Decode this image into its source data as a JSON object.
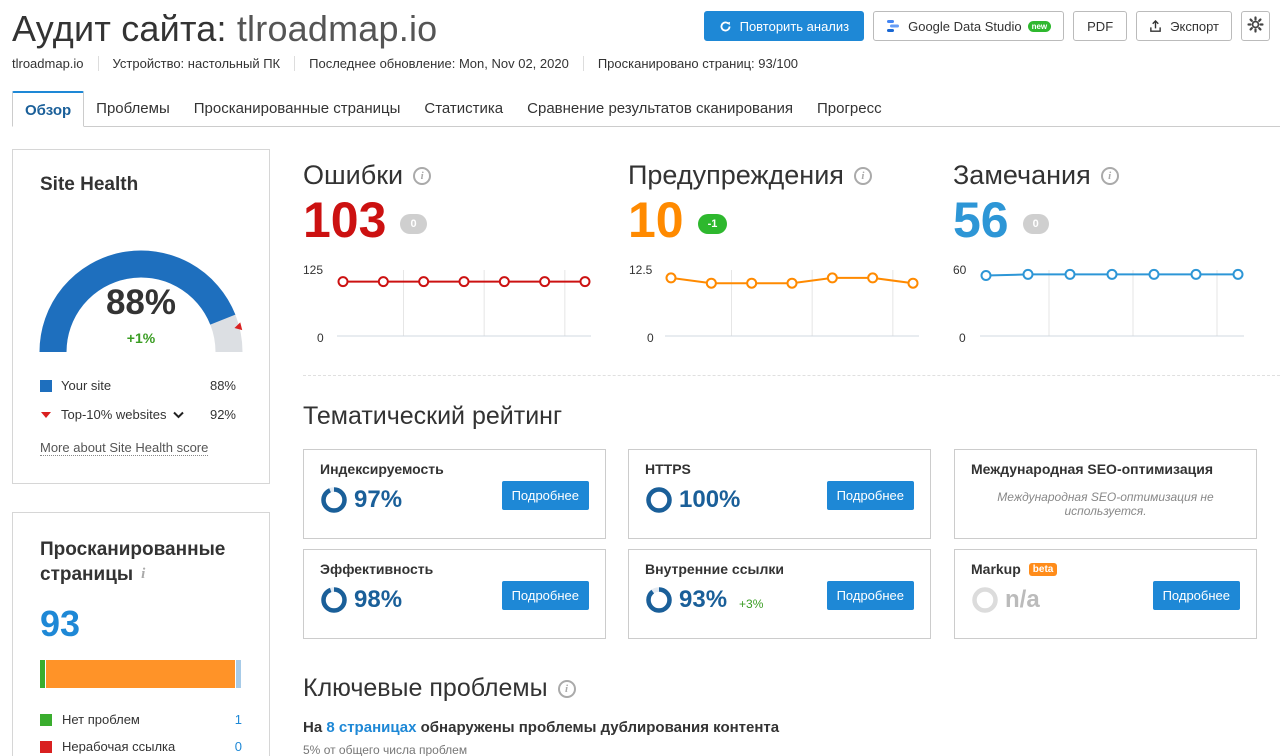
{
  "header": {
    "title_prefix": "Аудит сайта:",
    "title_domain": "tlroadmap.io"
  },
  "toolbar": {
    "rerun_label": "Повторить анализ",
    "gds_label": "Google Data Studio",
    "gds_badge": "new",
    "pdf_label": "PDF",
    "export_label": "Экспорт"
  },
  "meta": {
    "domain": "tlroadmap.io",
    "device": "Устройство: настольный ПК",
    "last_update": "Последнее обновление: Mon, Nov 02, 2020",
    "crawled": "Просканировано страниц: 93/100"
  },
  "tabs": [
    {
      "label": "Обзор",
      "active": true
    },
    {
      "label": "Проблемы"
    },
    {
      "label": "Просканированные страницы"
    },
    {
      "label": "Статистика"
    },
    {
      "label": "Сравнение результатов сканирования"
    },
    {
      "label": "Прогресс"
    }
  ],
  "site_health": {
    "title": "Site Health",
    "value": "88%",
    "value_fraction": 0.88,
    "delta": "+1%",
    "top10_fraction": 0.92,
    "your_site_label": "Your site",
    "your_site_value": "88%",
    "top10_label": "Top-10% websites",
    "top10_value": "92%",
    "more_link": "More about Site Health score",
    "colors": {
      "site": "#1e6fbe",
      "rest": "#dcdfe3",
      "marker": "#d92020"
    }
  },
  "crawled_pages": {
    "title_line1": "Просканированные",
    "title_line2": "страницы",
    "count": "93",
    "bar": [
      {
        "name": "Нет проблем",
        "count": 1,
        "color": "#3aad2e"
      },
      {
        "name": "Нерабочая ссылка",
        "count": 0,
        "color": "#d92020"
      },
      {
        "name": "segment-orange",
        "count": 91,
        "color": "#ff9328"
      },
      {
        "name": "segment-blue",
        "count": 1,
        "color": "#a7cbe8"
      }
    ],
    "statuses": [
      {
        "label": "Нет проблем",
        "value": "1",
        "color": "#3aad2e"
      },
      {
        "label": "Нерабочая ссылка",
        "value": "0",
        "color": "#d92020"
      }
    ]
  },
  "metrics": [
    {
      "name": "Ошибки",
      "value": "103",
      "badge": "0",
      "badge_color": "#cfcfcf",
      "color": "#cc1111",
      "y_max": "125",
      "y_min": "0",
      "y_max_num": 125,
      "series": [
        103,
        103,
        103,
        103,
        103,
        103,
        103
      ]
    },
    {
      "name": "Предупреждения",
      "value": "10",
      "badge": "-1",
      "badge_color": "#2eb82e",
      "color": "#ff8a00",
      "y_max": "12.5",
      "y_min": "0",
      "y_max_num": 12.5,
      "series": [
        11,
        10,
        10,
        10,
        11,
        11,
        10
      ]
    },
    {
      "name": "Замечания",
      "value": "56",
      "badge": "0",
      "badge_color": "#cfcfcf",
      "color": "#2d96d6",
      "y_max": "60",
      "y_min": "0",
      "y_max_num": 60,
      "series": [
        55,
        56,
        56,
        56,
        56,
        56,
        56
      ]
    }
  ],
  "thematic": {
    "title": "Тематический рейтинг",
    "details_label": "Подробнее",
    "cards": [
      {
        "name": "Индексируемость",
        "value": "97%",
        "fraction": 0.97
      },
      {
        "name": "HTTPS",
        "value": "100%",
        "fraction": 1.0
      },
      {
        "name": "Международная SEO-оптимизация",
        "note": "Международная SEO-оптимизация не используется."
      },
      {
        "name": "Эффективность",
        "value": "98%",
        "fraction": 0.98
      },
      {
        "name": "Внутренние ссылки",
        "value": "93%",
        "fraction": 0.93,
        "delta": "+3%"
      },
      {
        "name": "Markup",
        "badge": "beta",
        "value": "n/a",
        "fraction": 0
      }
    ]
  },
  "key_issues": {
    "title": "Ключевые проблемы",
    "line_prefix": "На",
    "line_link": "8 страницах",
    "line_suffix": "обнаружены проблемы дублирования контента",
    "sub_strong": "5%",
    "sub_text": "от общего числа проблем"
  }
}
